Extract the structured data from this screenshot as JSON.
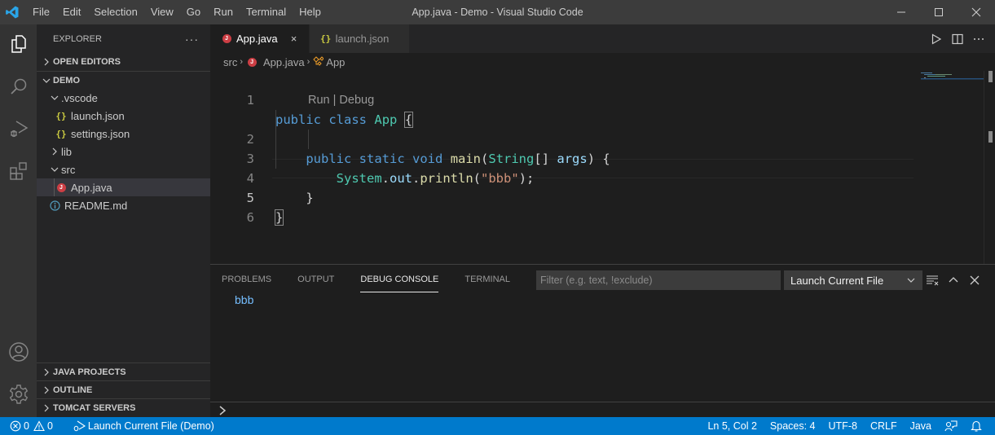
{
  "titlebar": {
    "title": "App.java - Demo - Visual Studio Code",
    "menu": [
      "File",
      "Edit",
      "Selection",
      "View",
      "Go",
      "Run",
      "Terminal",
      "Help"
    ]
  },
  "activity_bar": {
    "items": [
      "explorer-icon",
      "search-icon",
      "run-debug-icon",
      "extensions-icon"
    ],
    "bottom_items": [
      "accounts-icon",
      "manage-gear-icon"
    ]
  },
  "sidebar": {
    "header": "EXPLORER",
    "more": "···",
    "open_editors": "OPEN EDITORS",
    "workspace": "DEMO",
    "tree": [
      {
        "label": ".vscode",
        "type": "folder",
        "expanded": true
      },
      {
        "label": "launch.json",
        "type": "json"
      },
      {
        "label": "settings.json",
        "type": "json"
      },
      {
        "label": "lib",
        "type": "folder",
        "expanded": false
      },
      {
        "label": "src",
        "type": "folder",
        "expanded": true
      },
      {
        "label": "App.java",
        "type": "java",
        "selected": true
      },
      {
        "label": "README.md",
        "type": "info"
      }
    ],
    "bottom_sections": [
      "JAVA PROJECTS",
      "OUTLINE",
      "TOMCAT SERVERS"
    ]
  },
  "tabs": [
    {
      "label": "App.java",
      "active": true,
      "close": "×"
    },
    {
      "label": "launch.json",
      "active": false
    }
  ],
  "breadcrumb": [
    "src",
    "App.java",
    "App"
  ],
  "editor": {
    "codelens": "Run | Debug",
    "line_numbers": [
      "1",
      "2",
      "3",
      "4",
      "5",
      "6"
    ],
    "current_line": 5,
    "code": {
      "l1_kw1": "public",
      "l1_kw2": "class",
      "l1_cls": "App",
      "l1_brace": "{",
      "l2_kw1": "public",
      "l2_kw2": "static",
      "l2_kw3": "void",
      "l2_fn": "main",
      "l2_p1": "(",
      "l2_cls": "String",
      "l2_arr": "[]",
      "l2_var": "args",
      "l2_p2": ")",
      "l2_brace": "{",
      "l3_cls": "System",
      "l3_dot1": ".",
      "l3_var": "out",
      "l3_dot2": ".",
      "l3_fn": "println",
      "l3_p1": "(",
      "l3_str": "\"bbb\"",
      "l3_p2": ");",
      "l4_brace": "}",
      "l5_brace": "}"
    }
  },
  "panel": {
    "tabs": [
      "PROBLEMS",
      "OUTPUT",
      "DEBUG CONSOLE",
      "TERMINAL"
    ],
    "active_tab": "DEBUG CONSOLE",
    "filter_placeholder": "Filter (e.g. text, !exclude)",
    "filter_value": "",
    "launch_config": "Launch Current File",
    "output": "bbb",
    "repl_prompt": "›"
  },
  "statusbar": {
    "errors": "0",
    "warnings": "0",
    "debug_config": "Launch Current File (Demo)",
    "position": "Ln 5, Col 2",
    "spaces": "Spaces: 4",
    "encoding": "UTF-8",
    "eol": "CRLF",
    "language": "Java"
  },
  "colors": {
    "accent": "#007acc",
    "java_icon": "#cc3e44",
    "json_icon": "#cbcb41",
    "keyword": "#569cd6",
    "type": "#4ec9b0",
    "function": "#dcdcaa",
    "variable": "#9cdcfe",
    "string": "#ce9178"
  }
}
